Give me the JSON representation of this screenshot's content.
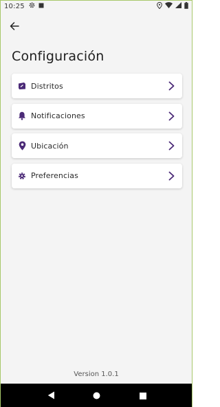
{
  "status_bar": {
    "time": "10:25",
    "icons": [
      "gear-icon",
      "square-icon",
      "location-icon",
      "wifi-icon",
      "signal-icon",
      "battery-icon"
    ]
  },
  "header": {
    "back_icon": "arrow-left-icon",
    "title": "Configuración"
  },
  "accent_color": "#4b2a77",
  "menu": {
    "items": [
      {
        "label": "Distritos",
        "icon": "district-icon"
      },
      {
        "label": "Notificaciones",
        "icon": "bell-icon"
      },
      {
        "label": "Ubicación",
        "icon": "location-pin-icon"
      },
      {
        "label": "Preferencias",
        "icon": "gear-icon"
      }
    ]
  },
  "footer": {
    "version": "Version 1.0.1"
  },
  "nav_bar": {
    "buttons": [
      "back-triangle-icon",
      "home-circle-icon",
      "recents-square-icon"
    ]
  }
}
